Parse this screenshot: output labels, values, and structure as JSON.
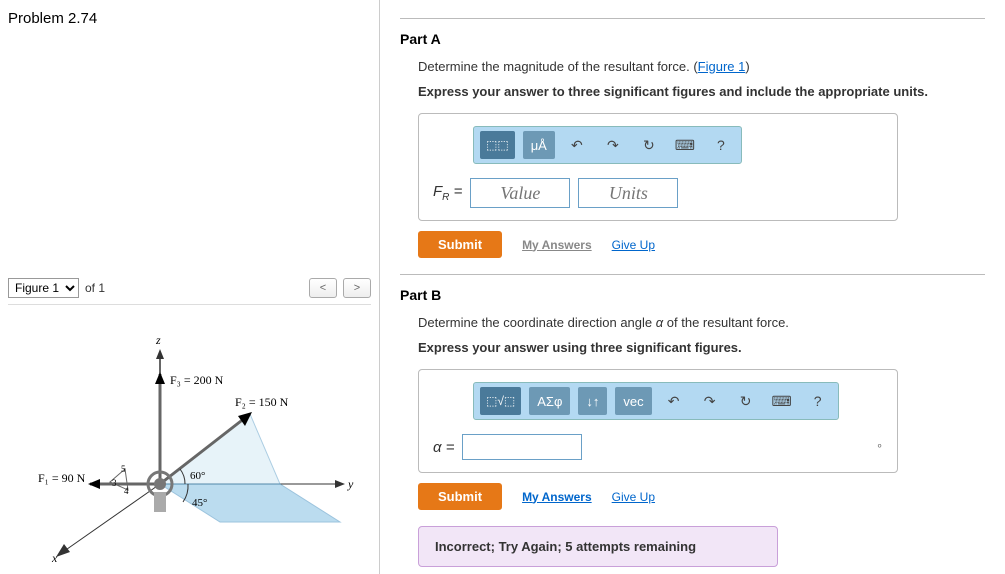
{
  "problem_title": "Problem 2.74",
  "figure_bar": {
    "select_label": "Figure 1",
    "of_label": "of 1",
    "prev": "<",
    "next": ">"
  },
  "figure": {
    "z_label": "z",
    "y_label": "y",
    "x_label": "x",
    "f1": "F₁ = 90 N",
    "f2": "F₂ = 150 N",
    "f3": "F₃ = 200 N",
    "angle1": "60°",
    "angle2": "45°",
    "small3": "3",
    "small4": "4",
    "small5": "5"
  },
  "part_a": {
    "label": "Part A",
    "question": "Determine the magnitude of the resultant force. (",
    "figure_link": "Figure 1",
    "question_close": ")",
    "instruction": "Express your answer to three significant figures and include the appropriate units.",
    "var_label_base": "F",
    "var_label_sub": "R",
    "equals": " =",
    "value_placeholder": "Value",
    "units_placeholder": "Units",
    "toolbar": {
      "templates": "⬚⬚",
      "units_btn": "μÅ",
      "undo": "↶",
      "redo": "↷",
      "reset": "↻",
      "keyboard": "⌨",
      "help": "?"
    },
    "submit": "Submit",
    "my_answers": "My Answers",
    "give_up": "Give Up"
  },
  "part_b": {
    "label": "Part B",
    "question_pre": "Determine the coordinate direction angle ",
    "question_var": "α",
    "question_post": " of the resultant force.",
    "instruction": "Express your answer using three significant figures.",
    "var_label": "α =",
    "degree": "∘",
    "toolbar": {
      "templates": "⬚√⬚",
      "greek": "ΑΣφ",
      "updown": "↓↑",
      "vec": "vec",
      "undo": "↶",
      "redo": "↷",
      "reset": "↻",
      "keyboard": "⌨",
      "help": "?"
    },
    "submit": "Submit",
    "my_answers": "My Answers",
    "give_up": "Give Up",
    "feedback": "Incorrect; Try Again; 5 attempts remaining"
  }
}
